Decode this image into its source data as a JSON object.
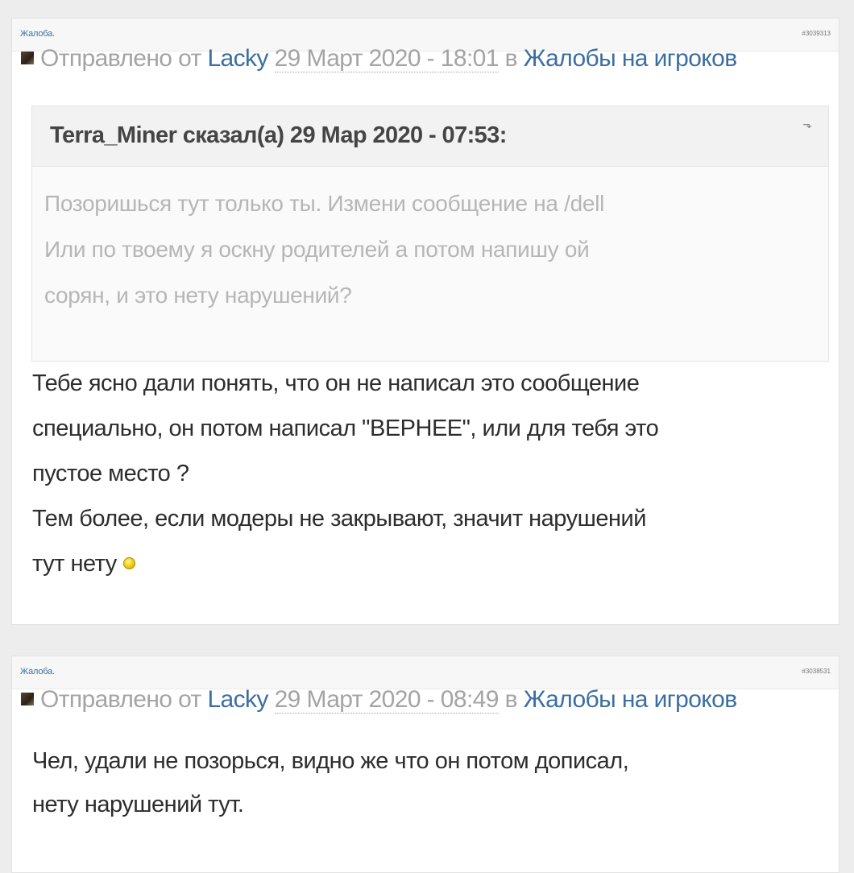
{
  "posts": [
    {
      "title": "Жалоба.",
      "post_id": "#3039313",
      "byline": {
        "sent_prefix": "Отправлено от",
        "author": "Lacky",
        "date": "29 Март 2020 - 18:01",
        "in_word": "в",
        "forum": "Жалобы на игроков"
      },
      "quote": {
        "citation": "Terra_Miner сказал(а) 29 Мар 2020 - 07:53:",
        "jump_icon": "return-arrow-icon",
        "lines": [
          "Позоришься тут только ты. Измени сообщение на /dell",
          "Или по твоему я оскну родителей а потом напишу ой",
          "сорян, и это нету нарушений?"
        ]
      },
      "body_lines": [
        "Тебе ясно дали понять, что он не написал это сообщение",
        "специально, он потом написал \"ВЕРНЕЕ\", или для тебя это",
        "пустое место ?",
        "Тем более, если модеры не закрывают, значит нарушений",
        "тут нету"
      ],
      "emoticon": "smiley-icon"
    },
    {
      "title": "Жалоба.",
      "post_id": "#3038531",
      "byline": {
        "sent_prefix": "Отправлено от",
        "author": "Lacky",
        "date": "29 Март 2020 - 08:49",
        "in_word": "в",
        "forum": "Жалобы на игроков"
      },
      "body_lines": [
        "Чел, удали не позорься, видно же что он потом дописал,",
        "нету нарушений тут."
      ]
    }
  ],
  "colors": {
    "page_background": "#ededed",
    "link": "#3b6ea1",
    "muted_text": "#a4a4a4",
    "quote_text": "#b6b6b6",
    "body_text": "#2d2d2d"
  }
}
